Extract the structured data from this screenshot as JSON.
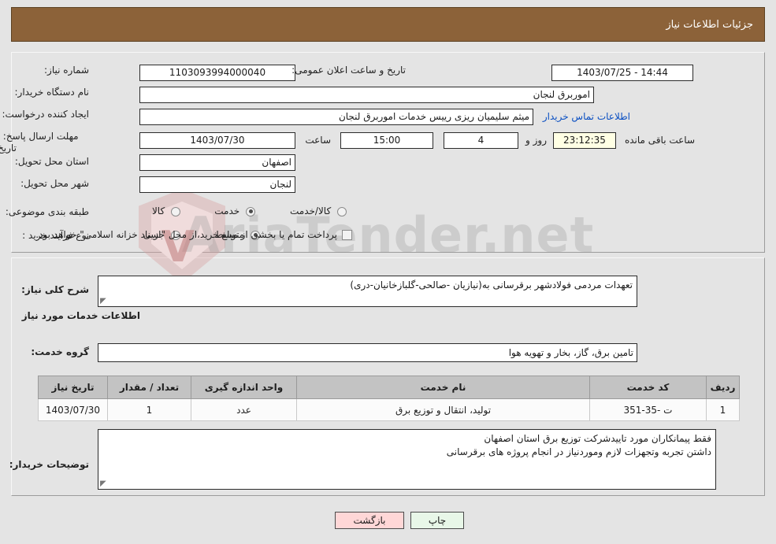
{
  "header": {
    "title": "جزئیات اطلاعات نیاز"
  },
  "watermark": {
    "text": "AriaTender.net"
  },
  "need_info": {
    "need_number": {
      "label": "شماره نیاز:",
      "value": "1103093994000040"
    },
    "buyer_org": {
      "label": "نام دستگاه خریدار:",
      "value": "اموربرق لنجان"
    },
    "creator": {
      "label": "ایجاد کننده درخواست:",
      "value": "میثم سلیمیان ریزی رییس خدمات  اموربرق لنجان"
    },
    "public_announce": {
      "label": "تاریخ و ساعت اعلان عمومی:",
      "value": "14:44 - 1403/07/25"
    },
    "buyer_contact_link": "اطلاعات تماس خریدار",
    "deadline": {
      "label": "مهلت ارسال پاسخ: تا تاریخ:",
      "date": "1403/07/30",
      "time_label": "ساعت",
      "time": "15:00",
      "days": "4",
      "days_suffix": "روز و",
      "countdown": "23:12:35",
      "countdown_suffix": "ساعت باقی مانده"
    },
    "delivery_province": {
      "label": "استان محل تحویل:",
      "value": "اصفهان"
    },
    "delivery_city": {
      "label": "شهر محل تحویل:",
      "value": "لنجان"
    },
    "category": {
      "label": "طبقه بندی موضوعی:",
      "options": [
        {
          "label": "کالا",
          "selected": false
        },
        {
          "label": "خدمت",
          "selected": true
        },
        {
          "label": "کالا/خدمت",
          "selected": false
        }
      ]
    },
    "purchase_type": {
      "label": "نوع فرآیند خرید :",
      "options": [
        {
          "label": "جزیی",
          "selected": false
        },
        {
          "label": "متوسط",
          "selected": true
        }
      ],
      "treasury_checkbox": {
        "checked": false,
        "label": "پرداخت تمام یا بخشی از مبلغ خرید،از محل \"اسناد خزانه اسلامی\" خواهد بود."
      }
    }
  },
  "need_summary": {
    "label": "شرح کلی نیاز:",
    "value": "تعهدات مردمی فولادشهر برقرسانی به(نیازیان -صالحی-گلبازخانیان-دری)"
  },
  "services_section": {
    "title": "اطلاعات خدمات مورد نیاز",
    "service_group": {
      "label": "گروه خدمت:",
      "value": "تامین برق، گاز، بخار و تهویه هوا"
    },
    "table": {
      "columns": [
        "ردیف",
        "کد خدمت",
        "نام خدمت",
        "واحد اندازه گیری",
        "تعداد / مقدار",
        "تاریخ نیاز"
      ],
      "rows": [
        {
          "row_no": "1",
          "service_code": "ت -35-351",
          "service_name": "تولید، انتقال و توزیع برق",
          "unit": "عدد",
          "quantity": "1",
          "need_date": "1403/07/30"
        }
      ]
    }
  },
  "buyer_notes": {
    "label": "توضیحات خریدار:",
    "line1": "فقط پیمانکاران مورد تاییدشرکت توزیع برق استان اصفهان",
    "line2": "داشتن تجربه وتجهزات لازم وموردنیاز در انجام پروژه های برقرسانی"
  },
  "footer": {
    "back_label": "بازگشت",
    "print_label": "چاپ"
  },
  "colors": {
    "header_bg": "#8c6239",
    "page_bg": "#e4e4e4",
    "link": "#0a4fc2",
    "timer_bg": "#ffffe4",
    "back_btn_bg": "#ffd7d7",
    "print_btn_bg": "#e8f7e8",
    "table_header_bg": "#c3c3c3"
  }
}
